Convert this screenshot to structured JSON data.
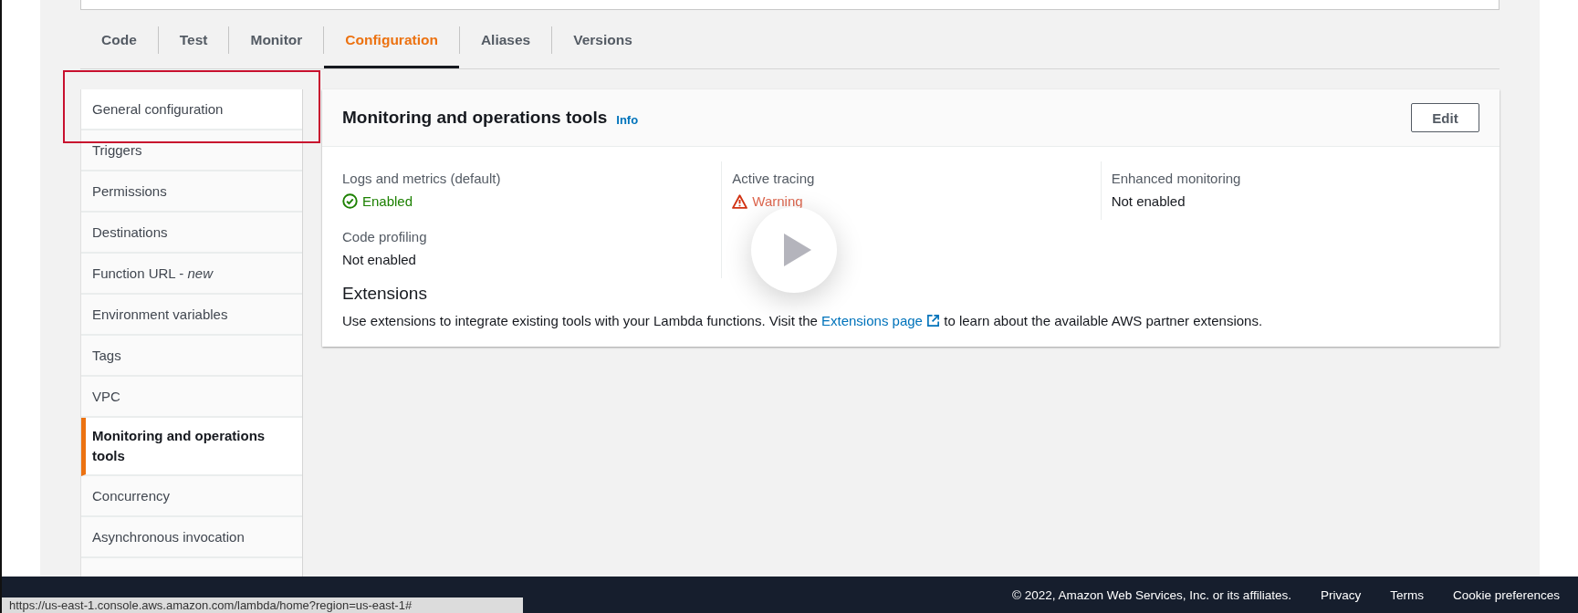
{
  "tabs": [
    {
      "label": "Code",
      "selected": false
    },
    {
      "label": "Test",
      "selected": false
    },
    {
      "label": "Monitor",
      "selected": false
    },
    {
      "label": "Configuration",
      "selected": true
    },
    {
      "label": "Aliases",
      "selected": false
    },
    {
      "label": "Versions",
      "selected": false
    }
  ],
  "sidebar": {
    "items": [
      {
        "label": "General configuration",
        "selected": false,
        "highlighted": true
      },
      {
        "label": "Triggers",
        "selected": false,
        "highlighted": false
      },
      {
        "label": "Permissions",
        "selected": false,
        "highlighted": false
      },
      {
        "label": "Destinations",
        "selected": false,
        "highlighted": false
      },
      {
        "label": "Function URL - *new*",
        "selected": false,
        "highlighted": false
      },
      {
        "label": "Environment variables",
        "selected": false,
        "highlighted": false
      },
      {
        "label": "Tags",
        "selected": false,
        "highlighted": false
      },
      {
        "label": "VPC",
        "selected": false,
        "highlighted": false
      },
      {
        "label": "Monitoring and operations tools",
        "selected": true,
        "highlighted": false
      },
      {
        "label": "Concurrency",
        "selected": false,
        "highlighted": false
      },
      {
        "label": "Asynchronous invocation",
        "selected": false,
        "highlighted": false
      }
    ]
  },
  "panel": {
    "title": "Monitoring and operations tools",
    "info": "Info",
    "edit_button": "Edit",
    "fields": [
      {
        "label": "Logs and metrics (default)",
        "value": "Enabled",
        "kind": "enabled"
      },
      {
        "label": "Active tracing",
        "value": "Warning",
        "kind": "warning"
      },
      {
        "label": "Enhanced monitoring",
        "value": "Not enabled",
        "kind": "plain"
      },
      {
        "label": "Code profiling",
        "value": "Not enabled",
        "kind": "plain"
      }
    ],
    "extensions": {
      "title": "Extensions",
      "text_before": "Use extensions to integrate existing tools with your Lambda functions. Visit the",
      "link": "Extensions page",
      "text_after": "to learn about the available AWS partner extensions."
    }
  },
  "footer": {
    "copyright": "© 2022, Amazon Web Services, Inc. or its affiliates.",
    "links": [
      "Privacy",
      "Terms",
      "Cookie preferences"
    ]
  },
  "status_url": "https://us-east-1.console.aws.amazon.com/lambda/home?region=us-east-1#"
}
